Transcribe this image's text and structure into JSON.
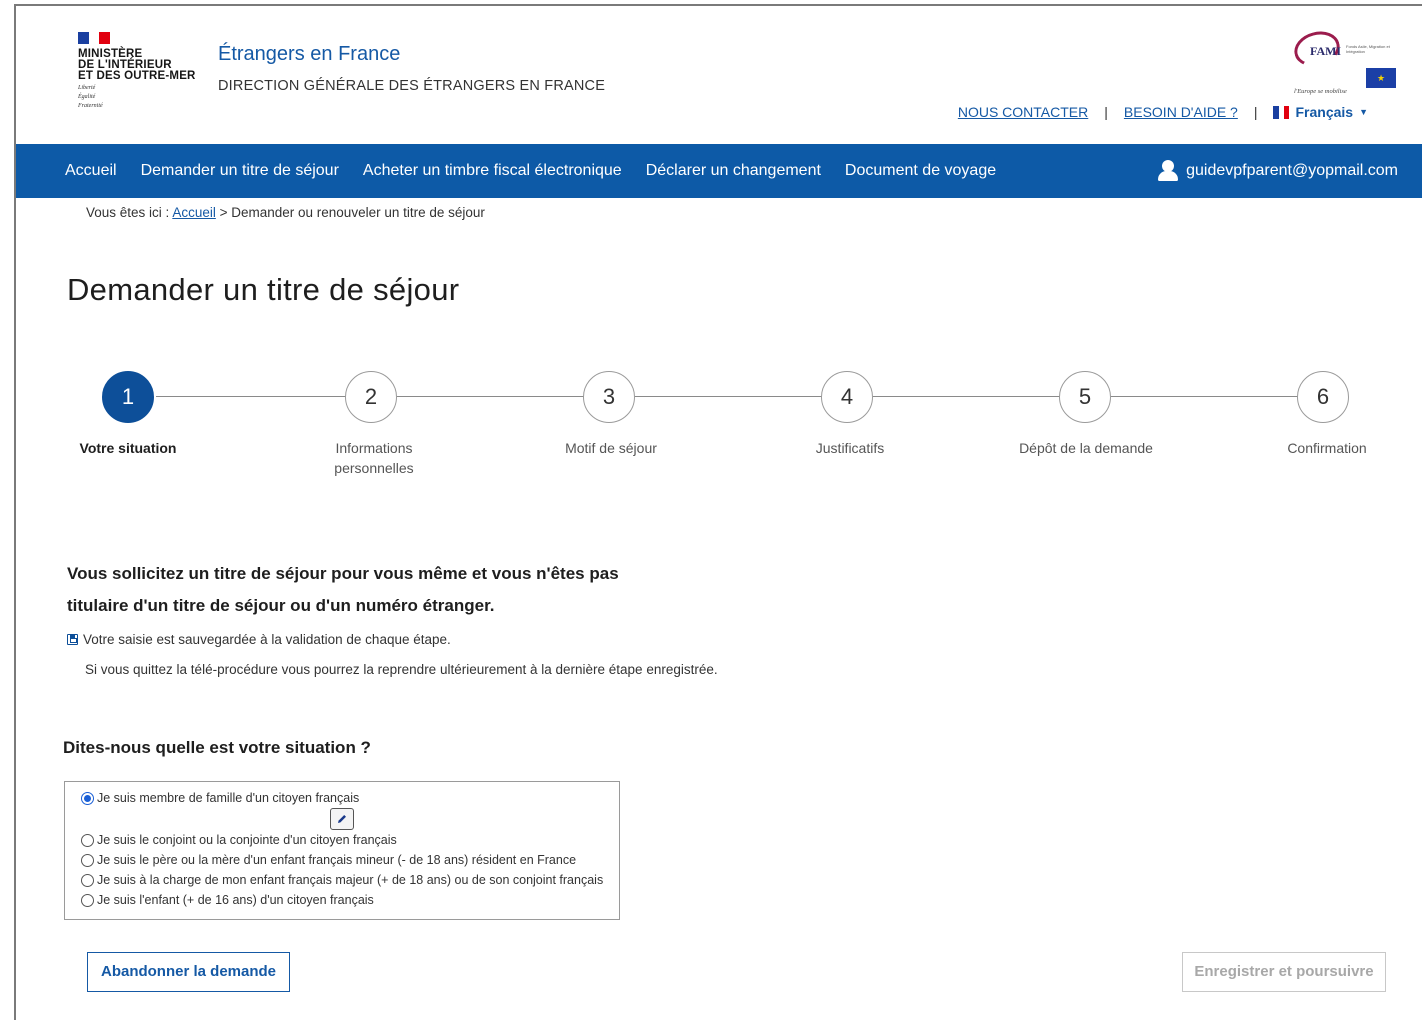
{
  "header": {
    "ministry_lines": [
      "MINISTÈRE",
      "DE L'INTÉRIEUR",
      "ET DES OUTRE-MER"
    ],
    "devise": [
      "Liberté",
      "Égalité",
      "Fraternité"
    ],
    "site_title": "Étrangers en France",
    "site_subtitle": "DIRECTION GÉNÉRALE DES ÉTRANGERS EN FRANCE",
    "fami": {
      "name": "FAMI",
      "small": "Fonds Asile, Migration et Intégration",
      "union": "Union européenne",
      "slogan": "l'Europe se mobilise"
    },
    "links": {
      "contact": "NOUS CONTACTER",
      "help": "BESOIN D'AIDE ?",
      "separator": "|",
      "language": "Français"
    }
  },
  "nav": {
    "items": [
      "Accueil",
      "Demander un titre de séjour",
      "Acheter un timbre fiscal électronique",
      "Déclarer un changement",
      "Document de voyage"
    ],
    "user_email": "guidevpfparent@yopmail.com"
  },
  "breadcrumb": {
    "prefix": "Vous êtes ici :",
    "home": "Accueil",
    "current": "> Demander ou renouveler un titre de séjour"
  },
  "page_title": "Demander un titre de séjour",
  "steps": [
    {
      "number": "1",
      "label": "Votre situation",
      "active": true
    },
    {
      "number": "2",
      "label": "Informations personnelles",
      "active": false
    },
    {
      "number": "3",
      "label": "Motif de séjour",
      "active": false
    },
    {
      "number": "4",
      "label": "Justificatifs",
      "active": false
    },
    {
      "number": "5",
      "label": "Dépôt de la demande",
      "active": false
    },
    {
      "number": "6",
      "label": "Confirmation",
      "active": false
    }
  ],
  "intro": {
    "line1": "Vous sollicitez un titre de séjour pour vous même et vous n'êtes pas",
    "line2": "titulaire d'un titre de séjour ou d'un numéro étranger."
  },
  "save_note": "Votre saisie est sauvegardée à la validation de chaque étape.",
  "resume_note": "Si vous quittez la télé-procédure vous pourrez la reprendre ultérieurement à la dernière étape enregistrée.",
  "question": "Dites-nous quelle est votre situation ?",
  "options": [
    {
      "label": "Je suis membre de famille d'un citoyen français",
      "checked": true
    },
    {
      "label": "Je suis le conjoint ou la conjointe d'un citoyen français",
      "checked": false
    },
    {
      "label": "Je suis le père ou la mère d'un enfant français mineur (- de 18 ans) résident en France",
      "checked": false
    },
    {
      "label": "Je suis à la charge de mon enfant français majeur (+ de 18 ans) ou de son conjoint français",
      "checked": false
    },
    {
      "label": "Je suis l'enfant (+ de 16 ans) d'un citoyen français",
      "checked": false
    }
  ],
  "buttons": {
    "abandon": "Abandonner la demande",
    "save": "Enregistrer et poursuivre"
  },
  "colors": {
    "primary": "#0d5aa7",
    "active_step": "#0d4f99",
    "link": "#1559a5",
    "disabled_text": "#a8a8a8"
  }
}
